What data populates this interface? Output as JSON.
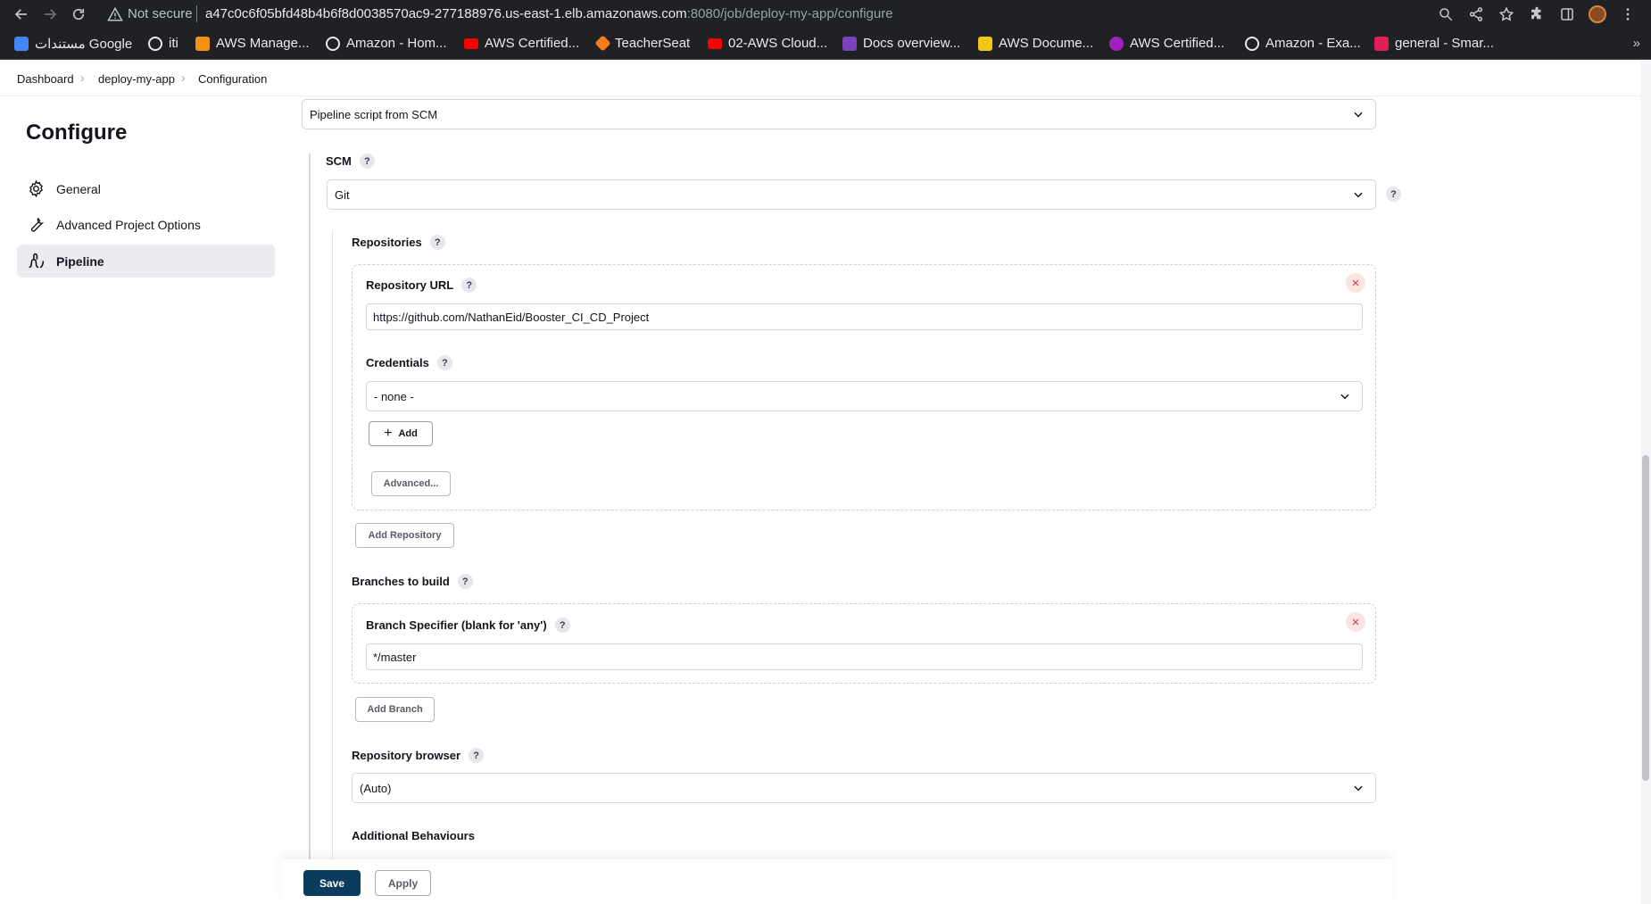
{
  "browser": {
    "security_label": "Not secure",
    "url_host": "a47c0c6f05bfd48b4b6f8d0038570ac9-277188976.us-east-1.elb.amazonaws.com",
    "url_rest": ":8080/job/deploy-my-app/configure"
  },
  "bookmarks": [
    {
      "label": "مستندات Google",
      "color": "#4285f4"
    },
    {
      "label": "iti",
      "color": "#e8eaed"
    },
    {
      "label": "AWS Manage...",
      "color": "#f29111"
    },
    {
      "label": "Amazon - Hom...",
      "color": "#e8eaed"
    },
    {
      "label": "AWS Certified...",
      "color": "#ff0000"
    },
    {
      "label": "TeacherSeat",
      "color": "#f47b20"
    },
    {
      "label": "02-AWS Cloud...",
      "color": "#ff0000"
    },
    {
      "label": "Docs overview...",
      "color": "#7b42bc"
    },
    {
      "label": "AWS Docume...",
      "color": "#f5c518"
    },
    {
      "label": "AWS Certified...",
      "color": "#a020c0"
    },
    {
      "label": "Amazon - Exa...",
      "color": "#e8eaed"
    },
    {
      "label": "general - Smar...",
      "color": "#e01e5a"
    }
  ],
  "breadcrumb": {
    "items": [
      "Dashboard",
      "deploy-my-app",
      "Configuration"
    ]
  },
  "sidebar": {
    "title": "Configure",
    "items": [
      {
        "label": "General",
        "icon": "gear-icon"
      },
      {
        "label": "Advanced Project Options",
        "icon": "wrench-icon"
      },
      {
        "label": "Pipeline",
        "icon": "pipeline-icon",
        "active": true
      }
    ]
  },
  "pipeline": {
    "definition": "Pipeline script from SCM",
    "scm_label": "SCM",
    "scm_value": "Git",
    "repositories_label": "Repositories",
    "repo_url_label": "Repository URL",
    "repo_url_value": "https://github.com/NathanEid/Booster_CI_CD_Project",
    "credentials_label": "Credentials",
    "credentials_value": "- none -",
    "add_label": "Add",
    "advanced_label": "Advanced...",
    "add_repository_label": "Add Repository",
    "branches_label": "Branches to build",
    "branch_specifier_label": "Branch Specifier (blank for 'any')",
    "branch_specifier_value": "*/master",
    "add_branch_label": "Add Branch",
    "repo_browser_label": "Repository browser",
    "repo_browser_value": "(Auto)",
    "additional_behaviours_label": "Additional Behaviours"
  },
  "footer": {
    "save_label": "Save",
    "apply_label": "Apply"
  },
  "colors": {
    "save_button": "#0b3c5d",
    "remove_icon": "#d13b3b",
    "active_sidebar": "#ebebf0"
  }
}
